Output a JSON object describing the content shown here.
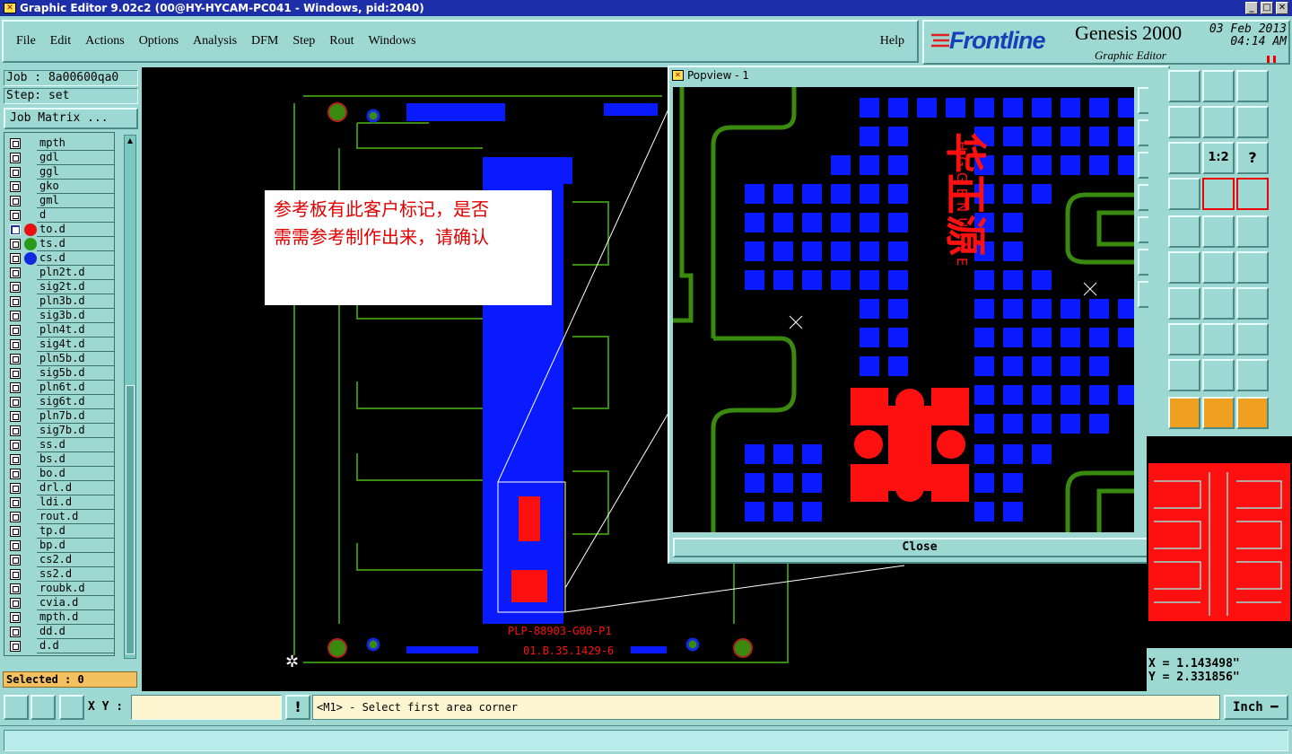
{
  "window": {
    "title": "Graphic Editor 9.02c2 (00@HY-HYCAM-PC041 - Windows, pid:2040)",
    "icon": "x-window-icon"
  },
  "menu": [
    "File",
    "Edit",
    "Actions",
    "Options",
    "Analysis",
    "DFM",
    "Step",
    "Rout",
    "Windows"
  ],
  "help": "Help",
  "logo": {
    "brand": "Frontline",
    "product": "Genesis 2000",
    "subtitle": "Graphic Editor",
    "date": "03 Feb 2013",
    "time": "04:14 AM"
  },
  "job": "Job : 8a00600qa0",
  "step": "Step: set",
  "job_matrix": "Job Matrix ...",
  "layers": [
    {
      "name": "mpth",
      "dot": ""
    },
    {
      "name": "gdl",
      "dot": ""
    },
    {
      "name": "ggl",
      "dot": ""
    },
    {
      "name": "gko",
      "dot": ""
    },
    {
      "name": "gml",
      "dot": ""
    },
    {
      "name": "d",
      "dot": ""
    },
    {
      "name": "to.d",
      "dot": "#e81010",
      "sel": true
    },
    {
      "name": "ts.d",
      "dot": "#2a9a18"
    },
    {
      "name": "cs.d",
      "dot": "#1028e0"
    },
    {
      "name": "pln2t.d",
      "dot": ""
    },
    {
      "name": "sig2t.d",
      "dot": ""
    },
    {
      "name": "pln3b.d",
      "dot": ""
    },
    {
      "name": "sig3b.d",
      "dot": ""
    },
    {
      "name": "pln4t.d",
      "dot": ""
    },
    {
      "name": "sig4t.d",
      "dot": ""
    },
    {
      "name": "pln5b.d",
      "dot": ""
    },
    {
      "name": "sig5b.d",
      "dot": ""
    },
    {
      "name": "pln6t.d",
      "dot": ""
    },
    {
      "name": "sig6t.d",
      "dot": ""
    },
    {
      "name": "pln7b.d",
      "dot": ""
    },
    {
      "name": "sig7b.d",
      "dot": ""
    },
    {
      "name": "ss.d",
      "dot": ""
    },
    {
      "name": "bs.d",
      "dot": ""
    },
    {
      "name": "bo.d",
      "dot": ""
    },
    {
      "name": "drl.d",
      "dot": ""
    },
    {
      "name": "ldi.d",
      "dot": ""
    },
    {
      "name": "rout.d",
      "dot": ""
    },
    {
      "name": "tp.d",
      "dot": ""
    },
    {
      "name": "bp.d",
      "dot": ""
    },
    {
      "name": "cs2.d",
      "dot": ""
    },
    {
      "name": "ss2.d",
      "dot": ""
    },
    {
      "name": "roubk.d",
      "dot": ""
    },
    {
      "name": "cvia.d",
      "dot": ""
    },
    {
      "name": "mpth.d",
      "dot": ""
    },
    {
      "name": "dd.d",
      "dot": ""
    },
    {
      "name": "d.d",
      "dot": ""
    }
  ],
  "selected": "Selected : 0",
  "note": {
    "line1": "参考板有此客户标记，是否",
    "line2": "需需参考制作出来，请确认"
  },
  "board_text": {
    "part": "PLP-88903-G00-P1",
    "code": "01.B.35.1429-6"
  },
  "popview": {
    "title": "Popview - 1",
    "close": "Close",
    "marking_cn": "华正源",
    "marking_en": "HGGENUINE"
  },
  "coords": {
    "x": "X = 1.143498\"",
    "y": "Y = 2.331856\""
  },
  "xy_label": "X Y :",
  "xy_value": "",
  "message": "<M1> - Select first area corner",
  "units": "Inch",
  "colors": {
    "pad": "#0a1aff",
    "trace": "#3a8a10",
    "marking": "#ff1010",
    "bg": "#9ed8d2",
    "titlebar": "#1d2fa8"
  }
}
